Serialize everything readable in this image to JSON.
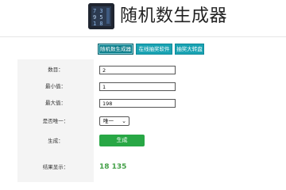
{
  "header": {
    "logo_icon": "calculator-digits-icon",
    "title": "随机数生成器"
  },
  "nav": {
    "items": [
      {
        "label": "随机数生成器",
        "active": true
      },
      {
        "label": "在线抽奖软件",
        "active": false
      },
      {
        "label": "抽奖大转盘",
        "active": false
      }
    ]
  },
  "form": {
    "count_label": "数目：",
    "count_value": "2",
    "min_label": "最小值：",
    "min_value": "1",
    "max_label": "最大值：",
    "max_value": "198",
    "unique_label": "是否唯一：",
    "unique_selected": "唯一",
    "generate_label": "生成：",
    "generate_button": "生成",
    "result_label": "结果显示：",
    "result_value": "18 135"
  },
  "colors": {
    "nav_button": "#1aa3b3",
    "nav_button_active": "#0e7f8c",
    "generate_button": "#28a745",
    "result_text": "#43a047"
  }
}
